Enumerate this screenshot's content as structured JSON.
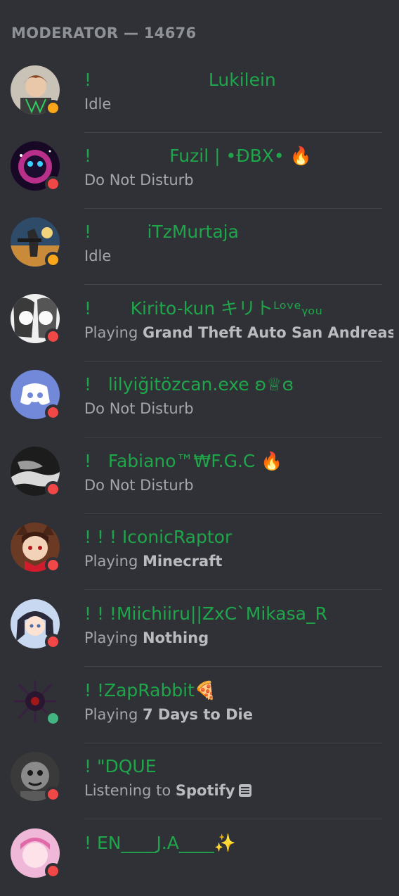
{
  "header": {
    "title": "MODERATOR — 14676"
  },
  "members": [
    {
      "name": "!                     Lukilein",
      "status_text": "Idle",
      "activity": "",
      "status": "idle"
    },
    {
      "name": "!              Fuzil | •ĐBX• 🔥",
      "status_text": "Do Not Disturb",
      "activity": "",
      "status": "dnd"
    },
    {
      "name": "!          iTzMurtaja",
      "status_text": "Idle",
      "activity": "",
      "status": "idle"
    },
    {
      "name": "!       Kirito-kun キリトᴸᵒᵛᵉᵧₒᵤ",
      "status_text": "Playing ",
      "activity": "Grand Theft Auto San Andreas",
      "status": "dnd"
    },
    {
      "name": "!   lilyiğitözcan.exe ʚ♕ɞ",
      "status_text": "Do Not Disturb",
      "activity": "",
      "status": "dnd"
    },
    {
      "name": "!   Fabiano™₩F.G.C 🔥",
      "status_text": "Do Not Disturb",
      "activity": "",
      "status": "dnd"
    },
    {
      "name": "! ! ! IconicRaptor",
      "status_text": "Playing ",
      "activity": "Minecraft",
      "status": "dnd"
    },
    {
      "name": "! ! !Miichiiru||ZxC`Mikasa_R",
      "status_text": "Playing ",
      "activity": "Nothing",
      "status": "dnd"
    },
    {
      "name": "! !ZapRabbit🍕",
      "status_text": "Playing ",
      "activity": "7 Days to Die",
      "status": "online"
    },
    {
      "name": "! \"DQUE",
      "status_text": "Listening to ",
      "activity": "Spotify",
      "status": "dnd"
    },
    {
      "name": "! EN____J.A____✨",
      "status_text": "",
      "activity": "",
      "status": "dnd"
    }
  ],
  "colors": {
    "background": "#2f3136",
    "name": "#1fa64a",
    "idle": "#faa61a",
    "dnd": "#f04747",
    "online": "#43b581",
    "discord_blurple": "#7289da"
  },
  "icons": {
    "activity_spotify": "document-icon"
  }
}
